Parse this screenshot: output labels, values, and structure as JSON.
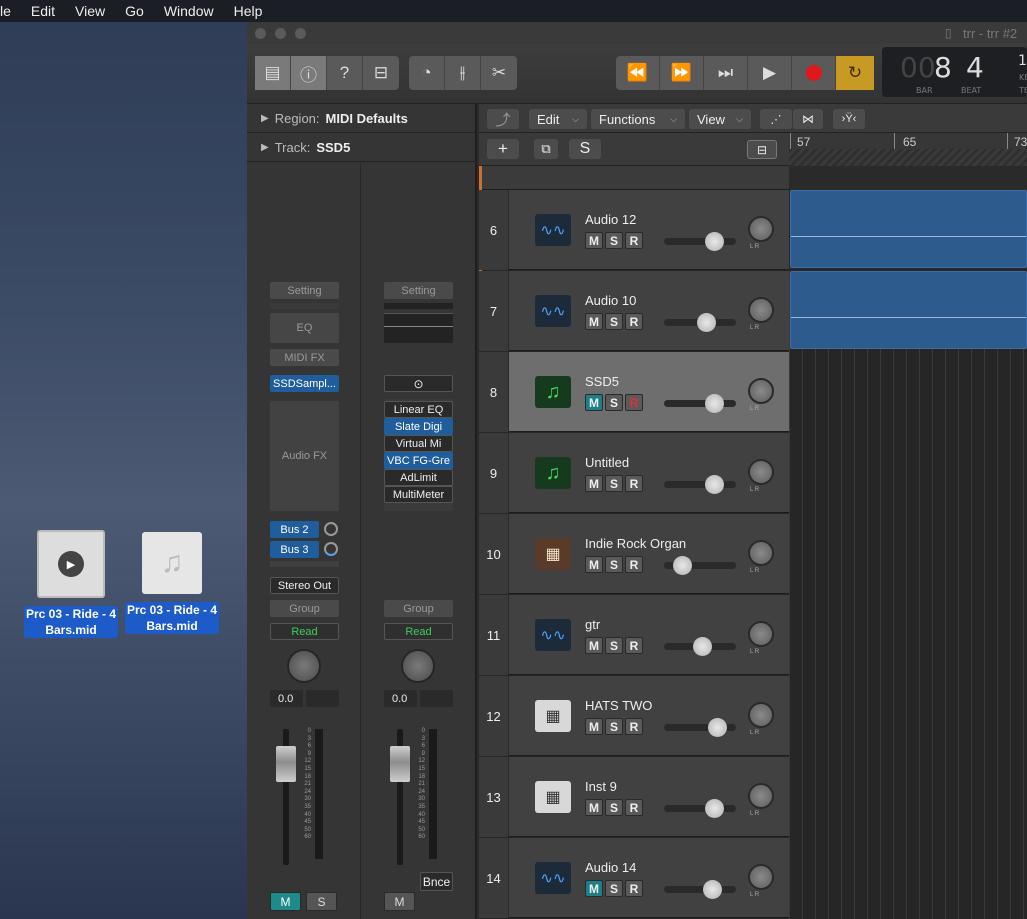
{
  "menubar": {
    "items": [
      "le",
      "Edit",
      "View",
      "Go",
      "Window",
      "Help"
    ]
  },
  "desktop": {
    "icons": [
      {
        "label_line1": "Prc 03 - Ride - 4",
        "label_line2": "Bars.mid"
      },
      {
        "label_line1": "Prc 03 - Ride - 4",
        "label_line2": "Bars.mid"
      }
    ]
  },
  "window": {
    "title": "trr - trr #2"
  },
  "lcd": {
    "bar_dim": "00",
    "bar": "8",
    "beat": "4",
    "bar_label": "BAR",
    "beat_label": "BEAT",
    "extra": "1(",
    "extra_label1": "KE",
    "extra_label2": "TE"
  },
  "inspector": {
    "region_label": "Region:",
    "region_value": "MIDI Defaults",
    "track_label": "Track:",
    "track_value": "SSD5",
    "strip1": {
      "setting": "Setting",
      "eq": "EQ",
      "midi_fx": "MIDI FX",
      "instrument": "SSDSampl...",
      "audio_fx": "Audio FX",
      "sends": [
        "Bus 2",
        "Bus 3"
      ],
      "output": "Stereo Out",
      "group": "Group",
      "automation": "Read",
      "volume": "0.0",
      "mute": "M",
      "solo": "S"
    },
    "strip2": {
      "setting": "Setting",
      "plugins": [
        "Linear EQ",
        "Slate Digi",
        "Virtual Mi",
        "VBC FG-Gre",
        "AdLimit",
        "MultiMeter"
      ],
      "group": "Group",
      "automation": "Read",
      "volume": "0.0",
      "bounce": "Bnce",
      "mute": "M"
    },
    "meter_scale": [
      "0",
      "3",
      "6",
      "9",
      "12",
      "15",
      "18",
      "21",
      "24",
      "30",
      "35",
      "40",
      "45",
      "50",
      "60"
    ]
  },
  "track_toolbar": {
    "edit": "Edit",
    "functions": "Functions",
    "view": "View",
    "add": "+",
    "s": "S"
  },
  "ruler": {
    "marks": [
      "57",
      "65",
      "73"
    ]
  },
  "tracks": [
    {
      "num": "6",
      "name": "Audio 12",
      "type": "audio",
      "vol": 0.7,
      "mute_on": false,
      "selected": false,
      "pan_lr": "L R"
    },
    {
      "num": "7",
      "name": "Audio 10",
      "type": "audio",
      "vol": 0.58,
      "mute_on": false,
      "selected": false,
      "pan_lr": "L R"
    },
    {
      "num": "8",
      "name": "SSD5",
      "type": "midi",
      "vol": 0.7,
      "mute_on": true,
      "selected": true,
      "pan_lr": "L R"
    },
    {
      "num": "9",
      "name": "Untitled",
      "type": "midi",
      "vol": 0.7,
      "mute_on": false,
      "selected": false,
      "pan_lr": "L R"
    },
    {
      "num": "10",
      "name": "Indie Rock Organ",
      "type": "organ",
      "vol": 0.25,
      "mute_on": false,
      "selected": false,
      "pan_lr": "L R"
    },
    {
      "num": "11",
      "name": "gtr",
      "type": "audio",
      "vol": 0.53,
      "mute_on": false,
      "selected": false,
      "pan_lr": "L R"
    },
    {
      "num": "12",
      "name": "HATS TWO",
      "type": "drum",
      "vol": 0.73,
      "mute_on": false,
      "selected": false,
      "pan_lr": "L R"
    },
    {
      "num": "13",
      "name": "Inst 9",
      "type": "drum",
      "vol": 0.7,
      "mute_on": false,
      "selected": false,
      "pan_lr": "L R"
    },
    {
      "num": "14",
      "name": "Audio 14",
      "type": "audio",
      "vol": 0.67,
      "mute_on": true,
      "selected": false,
      "pan_lr": "L R"
    }
  ],
  "track_buttons": {
    "m": "M",
    "s": "S",
    "r": "R"
  }
}
